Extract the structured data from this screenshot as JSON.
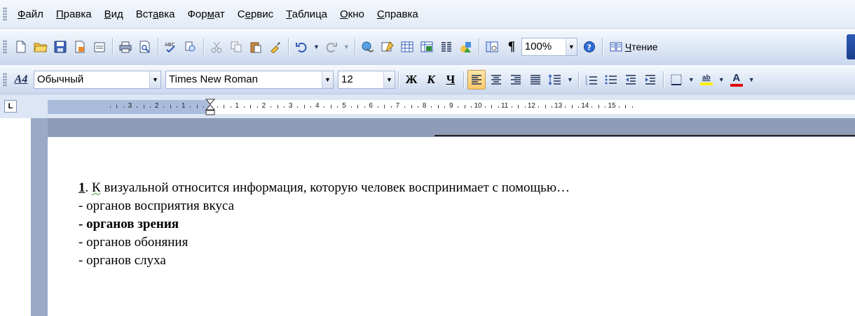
{
  "menu": {
    "items": [
      {
        "pre": "",
        "ul": "Ф",
        "post": "айл"
      },
      {
        "pre": "",
        "ul": "П",
        "post": "равка"
      },
      {
        "pre": "",
        "ul": "В",
        "post": "ид"
      },
      {
        "pre": "Вст",
        "ul": "а",
        "post": "вка"
      },
      {
        "pre": "Фор",
        "ul": "м",
        "post": "ат"
      },
      {
        "pre": "С",
        "ul": "е",
        "post": "рвис"
      },
      {
        "pre": "",
        "ul": "Т",
        "post": "аблица"
      },
      {
        "pre": "",
        "ul": "О",
        "post": "кно"
      },
      {
        "pre": "",
        "ul": "С",
        "post": "правка"
      }
    ]
  },
  "toolbar_standard": {
    "zoom": "100%",
    "read_prefix": "",
    "read_ul": "Ч",
    "read_post": "тение",
    "pilcrow": "¶"
  },
  "toolbar_format": {
    "style_icon_text": "A4",
    "style": "Обычный",
    "font": "Times New Roman",
    "size": "12",
    "bold_label": "Ж",
    "italic_label": "К",
    "underline_label": "Ч",
    "highlight_label": "ab",
    "font_color_label": "A",
    "colors": {
      "highlight": "#ffee00",
      "font_color": "#e00000",
      "active": "#ffc86a"
    }
  },
  "ruler": {
    "corner": "L",
    "left_numbers": [
      "3",
      "2",
      "1"
    ],
    "right_numbers": [
      "1",
      "2",
      "3",
      "4",
      "5",
      "6",
      "7",
      "8",
      "9",
      "10",
      "11",
      "12",
      "13",
      "14",
      "15"
    ]
  },
  "document": {
    "question_number": "1",
    "question_pre": ". ",
    "question_spell": "К",
    "question_rest": " визуальной относится информация, которую человек воспринимает с помощью…",
    "options": [
      {
        "text": "- органов восприятия вкуса",
        "bold": false
      },
      {
        "text": "- органов зрения",
        "bold": true
      },
      {
        "text": "- органов обоняния",
        "bold": false
      },
      {
        "text": "- органов слуха",
        "bold": false
      }
    ]
  }
}
